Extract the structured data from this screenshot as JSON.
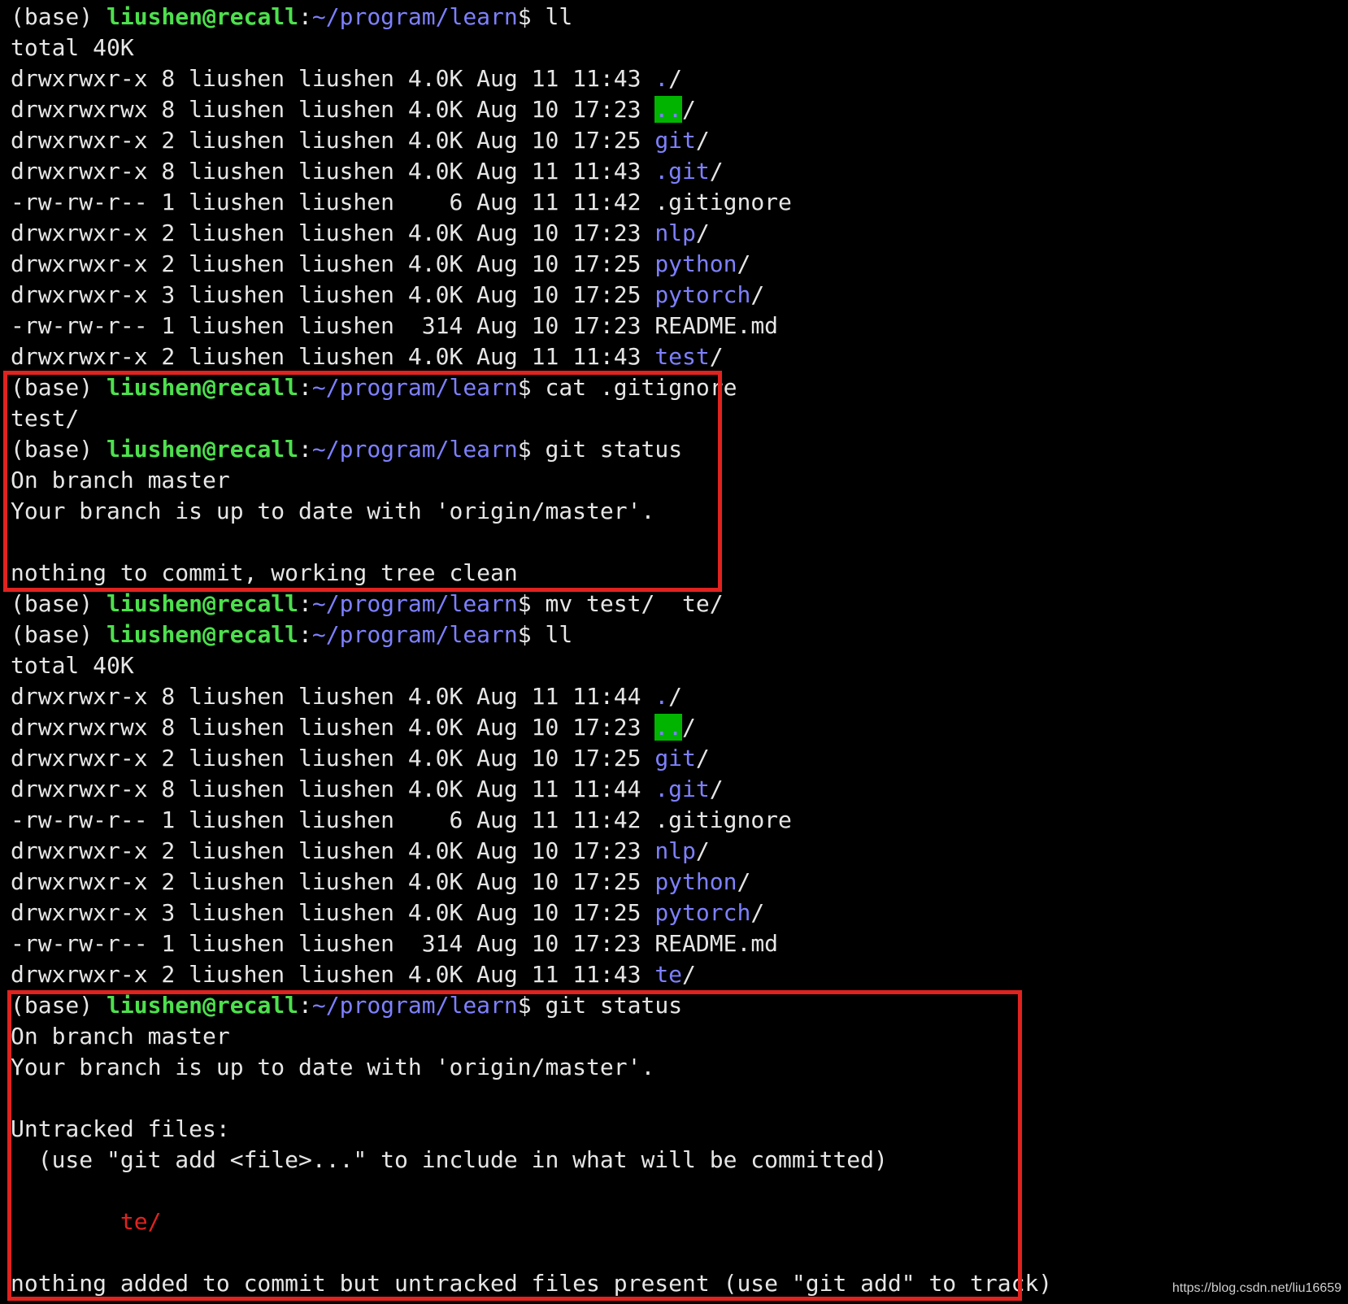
{
  "prompt": {
    "env": "(base) ",
    "user_host": "liushen@recall",
    "sep": ":",
    "path": "~/program/learn",
    "dollar": "$ "
  },
  "lines": [
    {
      "t": "prompt",
      "cmd": "ll"
    },
    {
      "t": "text",
      "text": "total 40K"
    },
    {
      "t": "ls",
      "meta": "drwxrwxr-x 8 liushen liushen 4.0K Aug 11 11:43 ",
      "name": ".",
      "kind": "dir"
    },
    {
      "t": "ls",
      "meta": "drwxrwxrwx 8 liushen liushen 4.0K Aug 10 17:23 ",
      "name": "..",
      "kind": "dirdot"
    },
    {
      "t": "ls",
      "meta": "drwxrwxr-x 2 liushen liushen 4.0K Aug 10 17:25 ",
      "name": "git",
      "kind": "dir"
    },
    {
      "t": "ls",
      "meta": "drwxrwxr-x 8 liushen liushen 4.0K Aug 11 11:43 ",
      "name": ".git",
      "kind": "dir"
    },
    {
      "t": "ls",
      "meta": "-rw-rw-r-- 1 liushen liushen    6 Aug 11 11:42 ",
      "name": ".gitignore",
      "kind": "file"
    },
    {
      "t": "ls",
      "meta": "drwxrwxr-x 2 liushen liushen 4.0K Aug 10 17:23 ",
      "name": "nlp",
      "kind": "dir"
    },
    {
      "t": "ls",
      "meta": "drwxrwxr-x 2 liushen liushen 4.0K Aug 10 17:25 ",
      "name": "python",
      "kind": "dir"
    },
    {
      "t": "ls",
      "meta": "drwxrwxr-x 3 liushen liushen 4.0K Aug 10 17:25 ",
      "name": "pytorch",
      "kind": "dir"
    },
    {
      "t": "ls",
      "meta": "-rw-rw-r-- 1 liushen liushen  314 Aug 10 17:23 ",
      "name": "README.md",
      "kind": "file"
    },
    {
      "t": "ls",
      "meta": "drwxrwxr-x 2 liushen liushen 4.0K Aug 11 11:43 ",
      "name": "test",
      "kind": "dir"
    },
    {
      "t": "prompt",
      "cmd": "cat .gitignore"
    },
    {
      "t": "text",
      "text": "test/"
    },
    {
      "t": "prompt",
      "cmd": "git status"
    },
    {
      "t": "text",
      "text": "On branch master"
    },
    {
      "t": "text",
      "text": "Your branch is up to date with 'origin/master'."
    },
    {
      "t": "text",
      "text": ""
    },
    {
      "t": "text",
      "text": "nothing to commit, working tree clean"
    },
    {
      "t": "prompt",
      "cmd": "mv test/  te/"
    },
    {
      "t": "prompt",
      "cmd": "ll"
    },
    {
      "t": "text",
      "text": "total 40K"
    },
    {
      "t": "ls",
      "meta": "drwxrwxr-x 8 liushen liushen 4.0K Aug 11 11:44 ",
      "name": ".",
      "kind": "dir"
    },
    {
      "t": "ls",
      "meta": "drwxrwxrwx 8 liushen liushen 4.0K Aug 10 17:23 ",
      "name": "..",
      "kind": "dirdot"
    },
    {
      "t": "ls",
      "meta": "drwxrwxr-x 2 liushen liushen 4.0K Aug 10 17:25 ",
      "name": "git",
      "kind": "dir"
    },
    {
      "t": "ls",
      "meta": "drwxrwxr-x 8 liushen liushen 4.0K Aug 11 11:44 ",
      "name": ".git",
      "kind": "dir"
    },
    {
      "t": "ls",
      "meta": "-rw-rw-r-- 1 liushen liushen    6 Aug 11 11:42 ",
      "name": ".gitignore",
      "kind": "file"
    },
    {
      "t": "ls",
      "meta": "drwxrwxr-x 2 liushen liushen 4.0K Aug 10 17:23 ",
      "name": "nlp",
      "kind": "dir"
    },
    {
      "t": "ls",
      "meta": "drwxrwxr-x 2 liushen liushen 4.0K Aug 10 17:25 ",
      "name": "python",
      "kind": "dir"
    },
    {
      "t": "ls",
      "meta": "drwxrwxr-x 3 liushen liushen 4.0K Aug 10 17:25 ",
      "name": "pytorch",
      "kind": "dir"
    },
    {
      "t": "ls",
      "meta": "-rw-rw-r-- 1 liushen liushen  314 Aug 10 17:23 ",
      "name": "README.md",
      "kind": "file"
    },
    {
      "t": "ls",
      "meta": "drwxrwxr-x 2 liushen liushen 4.0K Aug 11 11:43 ",
      "name": "te",
      "kind": "dir"
    },
    {
      "t": "prompt",
      "cmd": "git status"
    },
    {
      "t": "text",
      "text": "On branch master"
    },
    {
      "t": "text",
      "text": "Your branch is up to date with 'origin/master'."
    },
    {
      "t": "text",
      "text": ""
    },
    {
      "t": "text",
      "text": "Untracked files:"
    },
    {
      "t": "text",
      "text": "  (use \"git add <file>...\" to include in what will be committed)"
    },
    {
      "t": "text",
      "text": ""
    },
    {
      "t": "red",
      "text": "\tte/"
    },
    {
      "t": "text",
      "text": ""
    },
    {
      "t": "text",
      "text": "nothing added to commit but untracked files present (use \"git add\" to track)"
    }
  ],
  "watermark": "https://blog.csdn.net/liu16659",
  "colors": {
    "background": "#000000",
    "text": "#e6e6e6",
    "user_host": "#4de04d",
    "path_and_dirs": "#7e80ff",
    "parent_dir_bg": "#00b400",
    "untracked": "#e0231f",
    "highlight_box": "#e0231f"
  }
}
